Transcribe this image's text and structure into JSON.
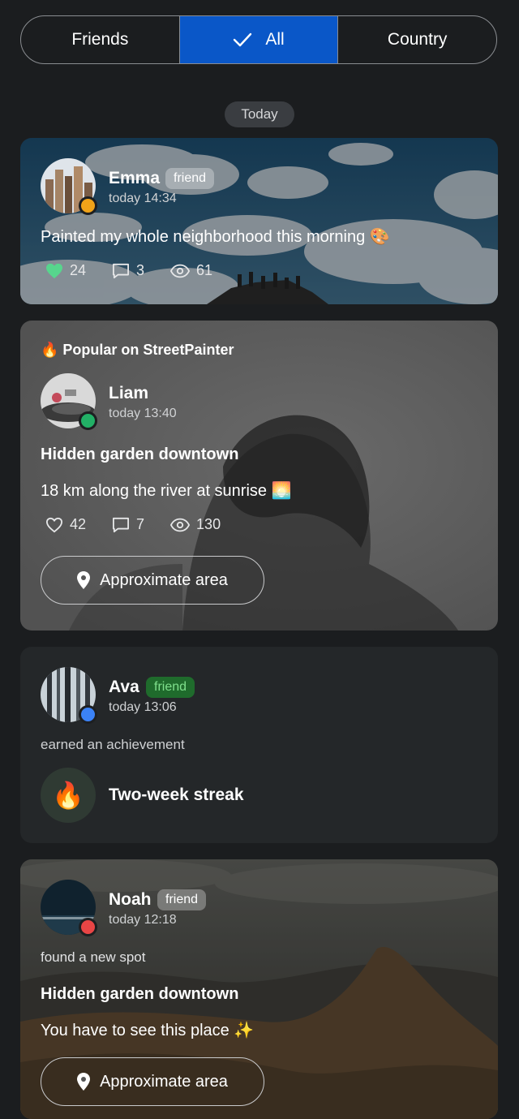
{
  "filter": {
    "tabs": [
      {
        "label": "Friends"
      },
      {
        "label": "All"
      },
      {
        "label": "Country"
      }
    ],
    "selected_index": 1
  },
  "date_section": "Today",
  "posts": [
    {
      "user": "Emma",
      "badge": "friend",
      "time": "today 14:34",
      "status_color": "#f0a319",
      "text": "Painted my whole neighborhood this morning 🎨",
      "likes": "24",
      "comments": "3",
      "views": "61",
      "liked": true
    },
    {
      "banner": "🔥 Popular on StreetPainter",
      "user": "Liam",
      "time": "today 13:40",
      "status_color": "#22b066",
      "title": "Hidden garden downtown",
      "text": "18 km along the river at sunrise 🌅",
      "likes": "42",
      "comments": "7",
      "views": "130",
      "location_label": "Approximate area"
    },
    {
      "user": "Ava",
      "badge": "friend",
      "time": "today 13:06",
      "status_color": "#3b82f6",
      "activity": "earned an achievement",
      "achievement_icon": "fire-icon",
      "achievement_emoji": "🔥",
      "achievement": "Two-week streak"
    },
    {
      "user": "Noah",
      "badge": "friend",
      "time": "today 12:18",
      "status_color": "#e84545",
      "activity": "found a new spot",
      "title": "Hidden garden downtown",
      "text": "You have to see this place ✨",
      "location_label": "Approximate area"
    }
  ],
  "colors": {
    "accent": "#0a57c8",
    "like_active": "#57d68d",
    "friend_badge_green": "#1f6b2c"
  }
}
